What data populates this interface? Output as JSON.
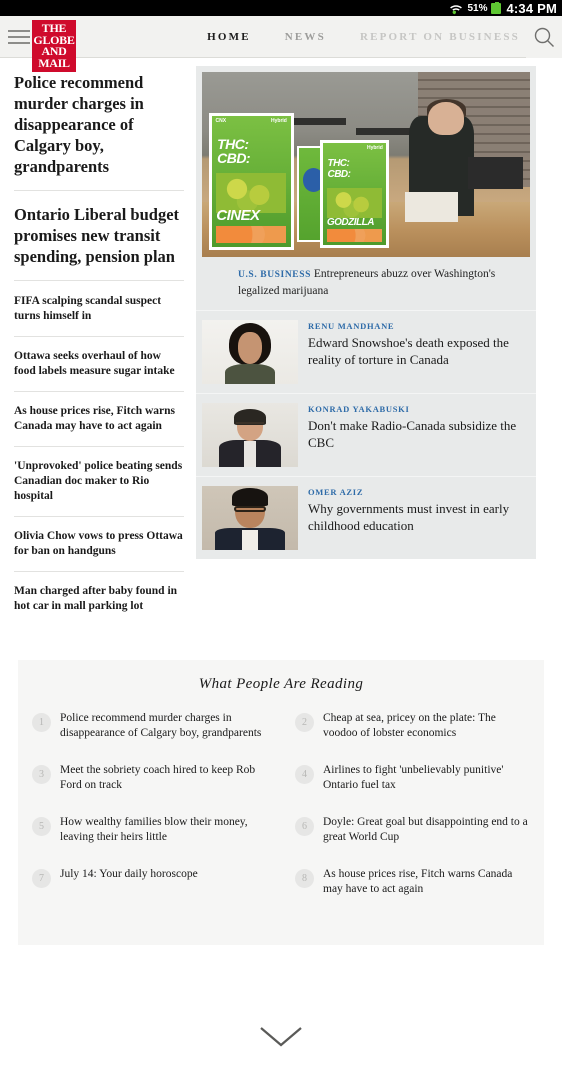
{
  "statusbar": {
    "battery_percent": "51%",
    "time": "4:34 PM",
    "wifi_icon": "wifi-icon",
    "battery_icon": "battery-icon"
  },
  "header": {
    "menu_icon": "hamburger-menu-icon",
    "search_icon": "search-icon",
    "logo": {
      "line1": "THE",
      "line2": "GLOBE",
      "line3": "AND",
      "line4": "MAIL",
      "leaf": "✿"
    },
    "nav": [
      {
        "label": "HOME",
        "state": "active"
      },
      {
        "label": "NEWS",
        "state": "dim"
      },
      {
        "label": "REPORT ON BUSINESS",
        "state": "faded"
      }
    ]
  },
  "left_column": {
    "lead_headlines": [
      "Police recommend murder charges in disappearance of Calgary boy, grandparents",
      "Ontario Liberal budget promises new transit spending, pension plan"
    ],
    "headlines": [
      "FIFA scalping scandal suspect turns himself in",
      "Ottawa seeks overhaul of how food labels measure sugar intake",
      "As house prices rise, Fitch warns Canada may have to act again",
      "'Unprovoked' police beating sends Canadian doc maker to Rio hospital",
      "Olivia Chow vows to press Ottawa for ban on handguns",
      "Man charged after baby found in hot car in mall parking lot"
    ]
  },
  "hero": {
    "image_name": "marijuana-dispensary-photo",
    "image_labels": {
      "box1_brand": "CNX",
      "box1_type": "Hybrid",
      "box1_thc": "THC:",
      "box1_cbd": "CBD:",
      "box1_name": "CINEX",
      "box2_type": "Hybrid",
      "box2_thc": "THC:",
      "box2_cbd": "CBD:",
      "box2_name": "GODZILLA"
    },
    "kicker": "U.S. BUSINESS",
    "caption": "Entrepreneurs abuzz over Washington's legalized marijuana"
  },
  "stories": [
    {
      "byline": "RENU MANDHANE",
      "headline": "Edward Snowshoe's death exposed the reality of torture in Canada",
      "thumb_name": "renu-mandhane-portrait"
    },
    {
      "byline": "KONRAD YAKABUSKI",
      "headline": "Don't make Radio-Canada subsidize the CBC",
      "thumb_name": "konrad-yakabuski-portrait"
    },
    {
      "byline": "OMER AZIZ",
      "headline": "Why governments must invest in early childhood education",
      "thumb_name": "omer-aziz-portrait"
    }
  ],
  "what_people_are_reading": {
    "title": "What People Are Reading",
    "items": [
      {
        "rank": "1",
        "headline": "Police recommend murder charges in disappearance of Calgary boy, grandparents"
      },
      {
        "rank": "2",
        "headline": "Cheap at sea, pricey on the plate: The voodoo of lobster economics"
      },
      {
        "rank": "3",
        "headline": "Meet the sobriety coach hired to keep Rob Ford on track"
      },
      {
        "rank": "4",
        "headline": "Airlines to fight 'unbelievably punitive' Ontario fuel tax"
      },
      {
        "rank": "5",
        "headline": "How wealthy families blow their money, leaving their heirs little"
      },
      {
        "rank": "6",
        "headline": "Doyle: Great goal but disappointing end to a great World Cup"
      },
      {
        "rank": "7",
        "headline": "July 14: Your daily horoscope"
      },
      {
        "rank": "8",
        "headline": "As house prices rise, Fitch warns Canada may have to act again"
      }
    ]
  },
  "footer": {
    "chevron_icon": "chevron-down-icon"
  },
  "colors": {
    "brand_red": "#cf0a2c",
    "link_blue": "#2e6ba8",
    "header_bg": "#f2f2f0",
    "panel_bg": "#e8eaea",
    "wpr_bg": "#f6f6f5",
    "battery_green": "#5ec832"
  }
}
